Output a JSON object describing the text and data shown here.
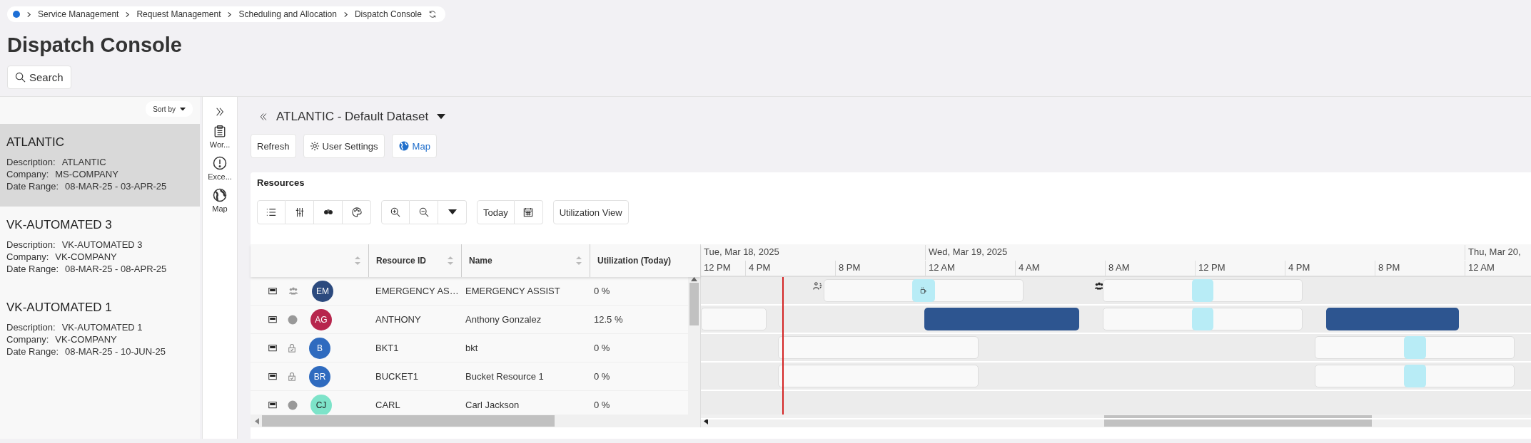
{
  "breadcrumb": [
    "Service Management",
    "Request Management",
    "Scheduling and Allocation",
    "Dispatch Console"
  ],
  "page_title": "Dispatch Console",
  "search_button": "Search",
  "datasets": {
    "sort_label": "Sort by",
    "items": [
      {
        "title": "ATLANTIC",
        "selected": true,
        "fields": [
          {
            "label": "Description:",
            "value": "ATLANTIC"
          },
          {
            "label": "Company:",
            "value": "MS-COMPANY"
          },
          {
            "label": "Date Range:",
            "value": "08-MAR-25 - 03-APR-25"
          }
        ]
      },
      {
        "title": "VK-AUTOMATED 3",
        "selected": false,
        "fields": [
          {
            "label": "Description:",
            "value": "VK-AUTOMATED 3"
          },
          {
            "label": "Company:",
            "value": "VK-COMPANY"
          },
          {
            "label": "Date Range:",
            "value": "08-MAR-25 - 08-APR-25"
          }
        ]
      },
      {
        "title": "VK-AUTOMATED 1",
        "selected": false,
        "fields": [
          {
            "label": "Description:",
            "value": "VK-AUTOMATED 1"
          },
          {
            "label": "Company:",
            "value": "VK-COMPANY"
          },
          {
            "label": "Date Range:",
            "value": "08-MAR-25 - 10-JUN-25"
          }
        ]
      }
    ]
  },
  "rail": [
    {
      "kind": "clipboard",
      "label": "Wor..."
    },
    {
      "kind": "alert",
      "label": "Exce..."
    },
    {
      "kind": "globe",
      "label": "Map"
    }
  ],
  "dataset_title": "ATLANTIC - Default Dataset",
  "actions": [
    {
      "kind": "plain",
      "label": "Refresh"
    },
    {
      "kind": "settings",
      "label": "User Settings"
    },
    {
      "kind": "map",
      "label": "Map"
    }
  ],
  "resources": {
    "title": "Resources",
    "today_button": "Today",
    "utilization_button": "Utilization View",
    "columns": [
      {
        "label": "Resource ID",
        "sortable": true
      },
      {
        "label": "Name",
        "sortable": true
      },
      {
        "label": "Utilization (Today)",
        "sortable": false
      }
    ],
    "rows": [
      {
        "kind": "team",
        "initials": "EM",
        "color": "#2c4a7e",
        "resource_id": "EMERGENCY AS…",
        "name": "EMERGENCY ASSIST",
        "utilization": "0 %",
        "bars": [
          {
            "kind": "walk_marker"
          },
          {
            "kind": "shift"
          },
          {
            "kind": "meal_break"
          },
          {
            "kind": "group_marker"
          },
          {
            "kind": "shift"
          },
          {
            "kind": "break"
          }
        ]
      },
      {
        "kind": "dot",
        "initials": "AG",
        "color": "#b7264d",
        "resource_id": "ANTHONY",
        "name": "Anthony Gonzalez",
        "utilization": "12.5 %",
        "bars": [
          {
            "kind": "shift"
          },
          {
            "kind": "assignment"
          },
          {
            "kind": "shift"
          },
          {
            "kind": "break"
          },
          {
            "kind": "assignment"
          }
        ]
      },
      {
        "kind": "lock",
        "initials": "B",
        "color": "#2f6bbf",
        "resource_id": "BKT1",
        "name": "bkt",
        "utilization": "0 %",
        "bars": [
          {
            "kind": "shift"
          },
          {
            "kind": "shift"
          },
          {
            "kind": "break"
          }
        ]
      },
      {
        "kind": "lock",
        "initials": "BR",
        "color": "#2f6bbf",
        "resource_id": "BUCKET1",
        "name": "Bucket Resource 1",
        "utilization": "0 %",
        "bars": [
          {
            "kind": "shift"
          },
          {
            "kind": "shift"
          },
          {
            "kind": "break"
          }
        ]
      },
      {
        "kind": "dot",
        "initials": "CJ",
        "color": "#7de3c9",
        "resource_id": "CARL",
        "name": "Carl Jackson",
        "utilization": "0 %",
        "bars": []
      }
    ]
  },
  "timeline": {
    "dates": [
      "Tue, Mar 18, 2025",
      "Wed, Mar 19, 2025",
      "Thu, Mar 20,"
    ],
    "hours": [
      "12 PM",
      "4 PM",
      "8 PM",
      "12 AM",
      "4 AM",
      "8 AM",
      "12 PM",
      "4 PM",
      "8 PM",
      "12 AM"
    ]
  }
}
